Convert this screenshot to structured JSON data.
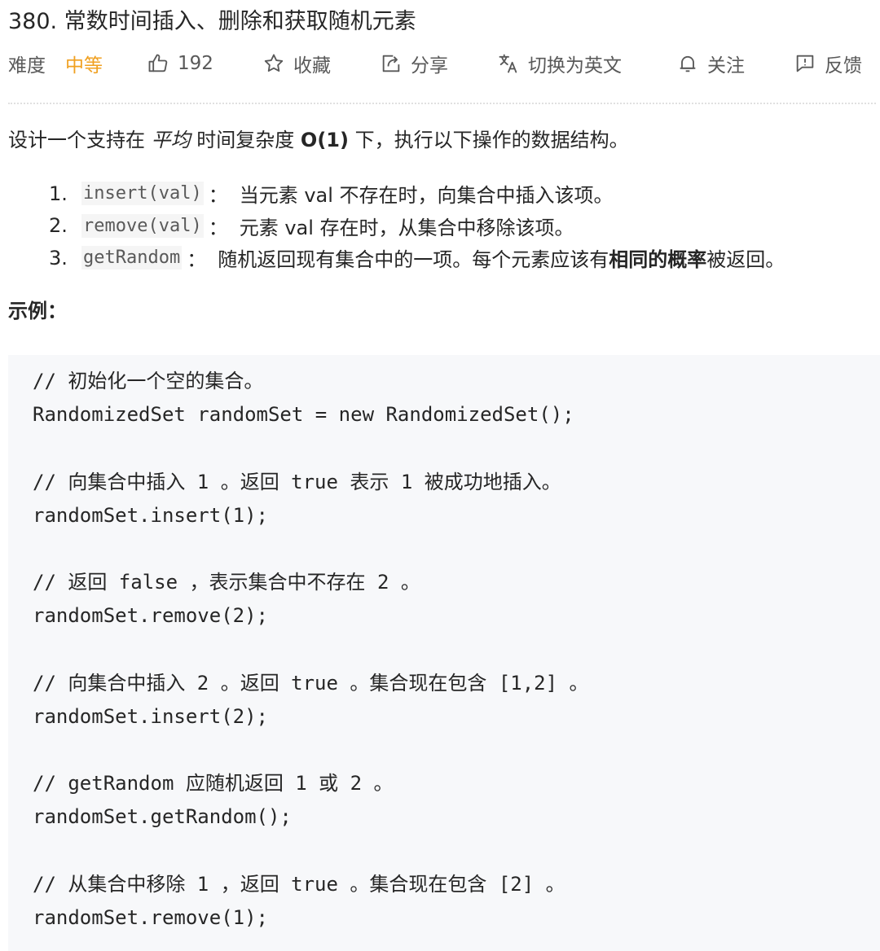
{
  "problem": {
    "title": "380. 常数时间插入、删除和获取随机元素",
    "difficulty_label": "难度",
    "difficulty_value": "中等",
    "likes": "192",
    "favorite_label": "收藏",
    "share_label": "分享",
    "translate_label": "切换为英文",
    "follow_label": "关注",
    "feedback_label": "反馈"
  },
  "icons": {
    "like": "thumbs-up-icon",
    "favorite": "star-icon",
    "share": "share-icon",
    "translate": "translate-icon",
    "follow": "bell-icon",
    "feedback": "feedback-icon"
  },
  "colors": {
    "difficulty_medium": "#f0a020",
    "code_background": "#f7f8fa"
  },
  "description": {
    "part1": "设计一个支持在",
    "em": "平均",
    "part2": "时间复杂度",
    "bold": "O(1)",
    "part3": "下，执行以下操作的数据结构。"
  },
  "operations": [
    {
      "num": "1.",
      "code": "insert(val)",
      "colon": "：",
      "text": "当元素 val 不存在时，向集合中插入该项。",
      "bold": "",
      "text_after": ""
    },
    {
      "num": "2.",
      "code": "remove(val)",
      "colon": "：",
      "text": "元素 val 存在时，从集合中移除该项。",
      "bold": "",
      "text_after": ""
    },
    {
      "num": "3.",
      "code": "getRandom",
      "colon": "：",
      "text": "随机返回现有集合中的一项。每个元素应该有",
      "bold": "相同的概率",
      "text_after": "被返回。"
    }
  ],
  "example_label": "示例：",
  "code_lines": [
    "// 初始化一个空的集合。",
    "RandomizedSet randomSet = new RandomizedSet();",
    "",
    "// 向集合中插入 1 。返回 true 表示 1 被成功地插入。",
    "randomSet.insert(1);",
    "",
    "// 返回 false ，表示集合中不存在 2 。",
    "randomSet.remove(2);",
    "",
    "// 向集合中插入 2 。返回 true 。集合现在包含 [1,2] 。",
    "randomSet.insert(2);",
    "",
    "// getRandom 应随机返回 1 或 2 。",
    "randomSet.getRandom();",
    "",
    "// 从集合中移除 1 ，返回 true 。集合现在包含 [2] 。",
    "randomSet.remove(1);"
  ]
}
